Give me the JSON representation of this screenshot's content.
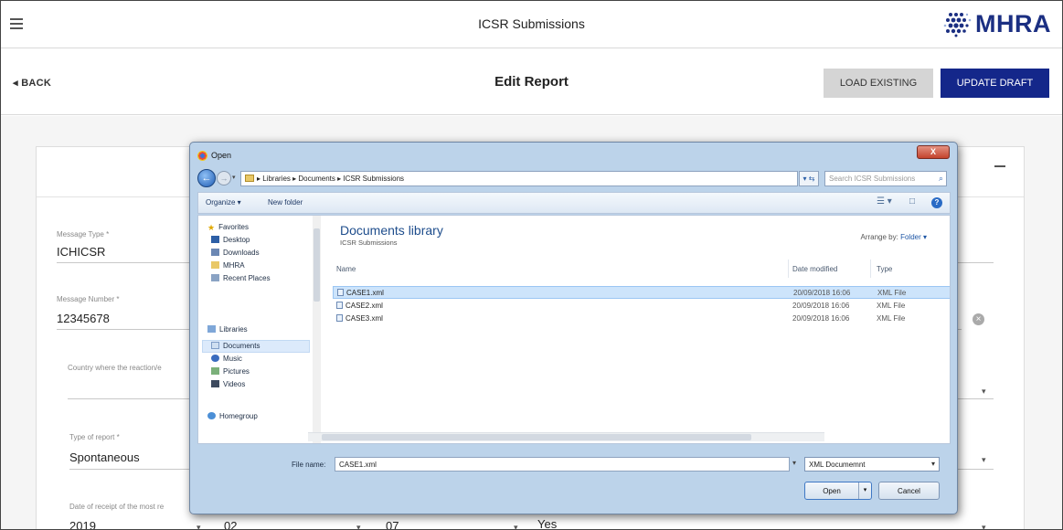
{
  "app": {
    "title": "ICSR Submissions",
    "logo_text": "MHRA",
    "brand_color": "#14278a"
  },
  "header": {
    "back_label": "BACK",
    "page_title": "Edit Report",
    "load_existing_label": "LOAD EXISTING",
    "update_draft_label": "UPDATE DRAFT"
  },
  "form": {
    "fields": [
      {
        "label": "Message Type *",
        "value": "ICHICSR"
      },
      {
        "label": "Message Number *",
        "value": "12345678"
      },
      {
        "label": "Country where the reaction/e",
        "value": ""
      },
      {
        "label": "Type of report *",
        "value": "Spontaneous"
      },
      {
        "label": "Date of receipt of the most re",
        "value": "2019"
      }
    ],
    "date_month": "02",
    "date_day": "07",
    "yes_value": "Yes"
  },
  "dialog": {
    "title": "Open",
    "close_label": "X",
    "address": {
      "crumbs": [
        "Libraries",
        "Documents",
        "ICSR Submissions"
      ],
      "search_placeholder": "Search ICSR Submissions"
    },
    "toolbar": {
      "organize_label": "Organize ▾",
      "new_folder_label": "New folder"
    },
    "nav": {
      "favorites": "Favorites",
      "desktop": "Desktop",
      "downloads": "Downloads",
      "mhra": "MHRA",
      "recent": "Recent Places",
      "libraries": "Libraries",
      "documents": "Documents",
      "music": "Music",
      "pictures": "Pictures",
      "videos": "Videos",
      "homegroup": "Homegroup"
    },
    "library": {
      "title": "Documents library",
      "subtitle": "ICSR Submissions",
      "arrange_label": "Arrange by:",
      "arrange_value": "Folder ▾"
    },
    "columns": {
      "name": "Name",
      "date": "Date modified",
      "type": "Type"
    },
    "files": [
      {
        "name": "CASE1.xml",
        "date": "20/09/2018 16:06",
        "type": "XML File"
      },
      {
        "name": "CASE2.xml",
        "date": "20/09/2018 16:06",
        "type": "XML File"
      },
      {
        "name": "CASE3.xml",
        "date": "20/09/2018 16:06",
        "type": "XML File"
      }
    ],
    "filename_label": "File name:",
    "filename_value": "CASE1.xml",
    "filetype_value": "XML Documemnt",
    "open_label": "Open",
    "cancel_label": "Cancel"
  }
}
